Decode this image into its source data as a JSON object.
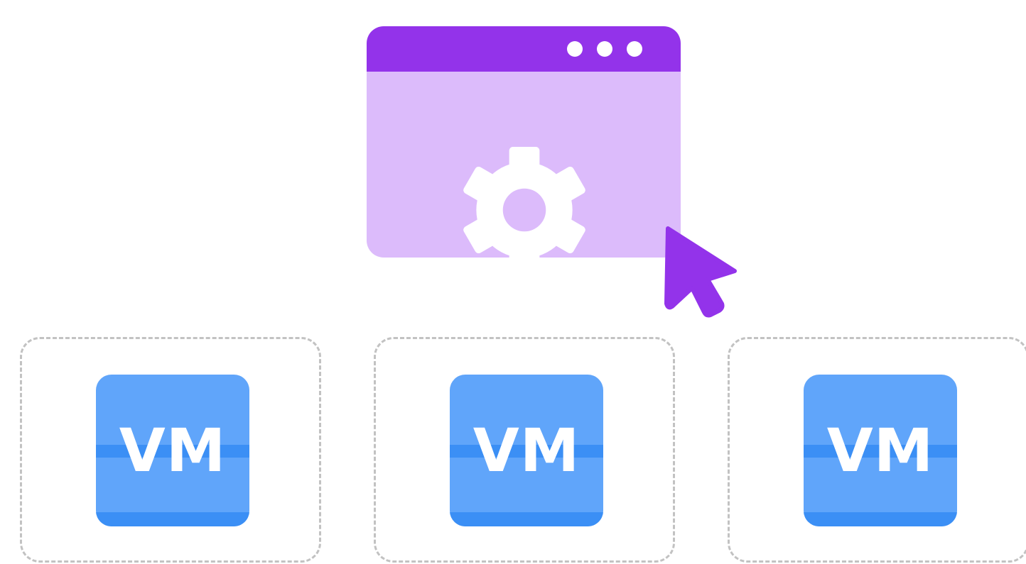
{
  "colors": {
    "window_titlebar": "#9333ea",
    "window_body": "#dcbbfb",
    "gear": "#ffffff",
    "gear_hole": "#dcbbfb",
    "cursor": "#9333ea",
    "vm_tile": "#60a5fa",
    "vm_stripe": "#3b8ff5",
    "panel_border": "#c2c2c2"
  },
  "settings_window": {
    "titlebar_dots": 3,
    "icon": "gear-icon",
    "pointer": "cursor-arrow-icon"
  },
  "vm_panels": [
    {
      "label": "VM"
    },
    {
      "label": "VM"
    },
    {
      "label": "VM"
    }
  ]
}
